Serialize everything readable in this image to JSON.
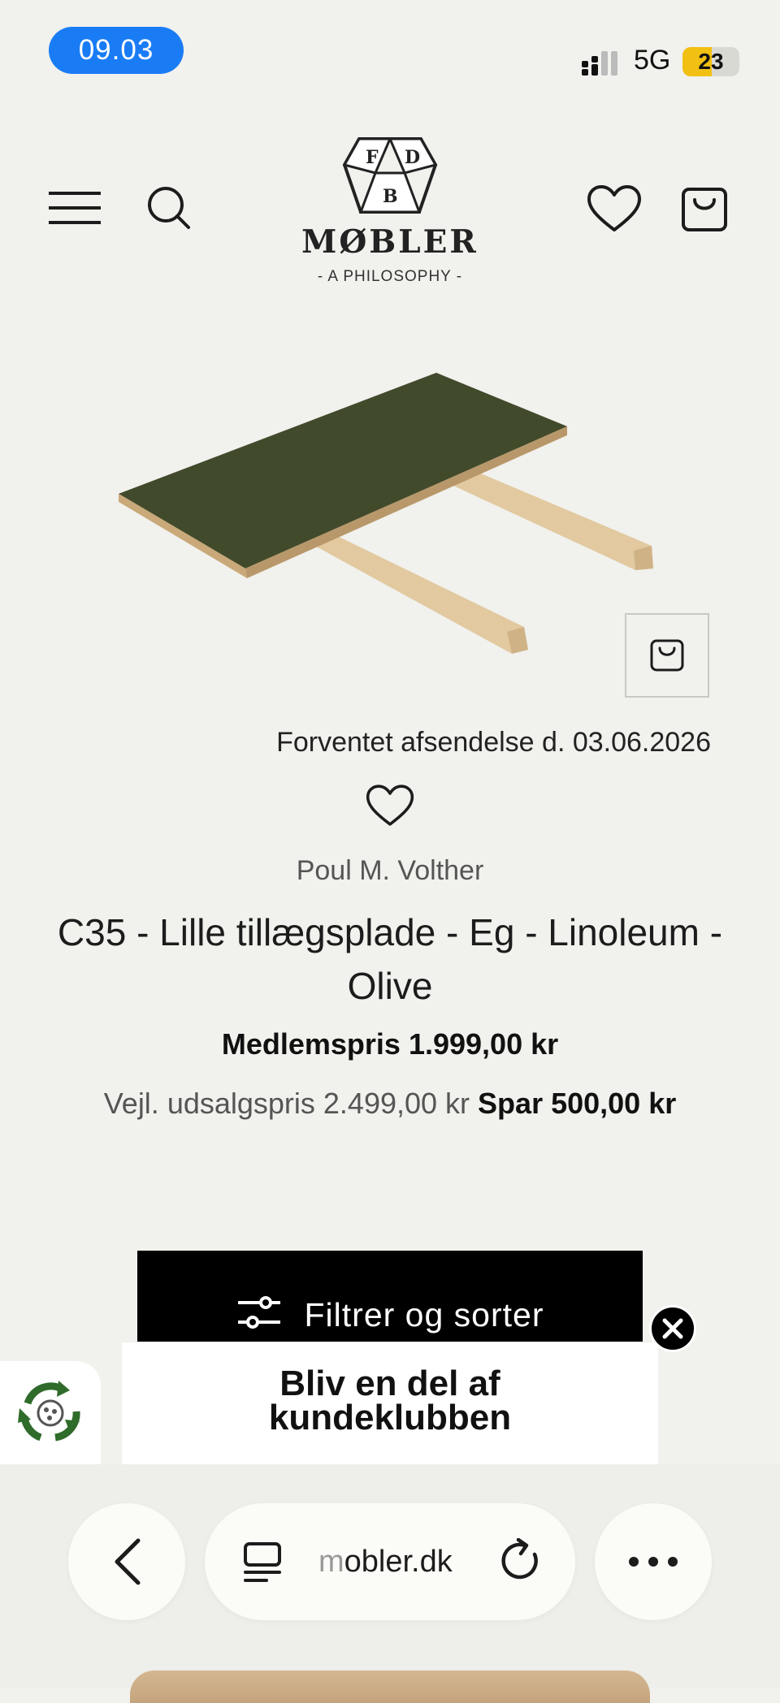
{
  "status_bar": {
    "time": "09.03",
    "network": "5G",
    "battery": "23",
    "battery_color": "#f2c012",
    "time_pill_color": "#1a7cf5"
  },
  "header": {
    "logo_letters": [
      "F",
      "D",
      "B"
    ],
    "logo_name": "MØBLER",
    "logo_tagline": "- A PHILOSOPHY -"
  },
  "product": {
    "shipping": "Forventet afsendelse d. 03.06.2026",
    "designer": "Poul M. Volther",
    "title": "C35 - Lille tillægsplade - Eg - Linoleum - Olive",
    "member_price": "Medlemspris 1.999,00 kr",
    "retail_price": "Vejl. udsalgspris 2.499,00 kr",
    "savings": "Spar 500,00 kr",
    "linoleum_color": "#424a2c",
    "wood_color": "#e2c9a0"
  },
  "filter": {
    "label": "Filtrer og sorter"
  },
  "club_popup": {
    "line1": "Bliv en del af",
    "line2": "kundeklubben"
  },
  "browser": {
    "url_prefix": "m",
    "url": "obler.dk"
  },
  "icons": [
    "menu-icon",
    "search-icon",
    "heart-icon",
    "bag-icon",
    "close-icon",
    "recycle-icon",
    "back-icon",
    "reader-icon",
    "reload-icon",
    "more-icon",
    "sliders-icon"
  ]
}
